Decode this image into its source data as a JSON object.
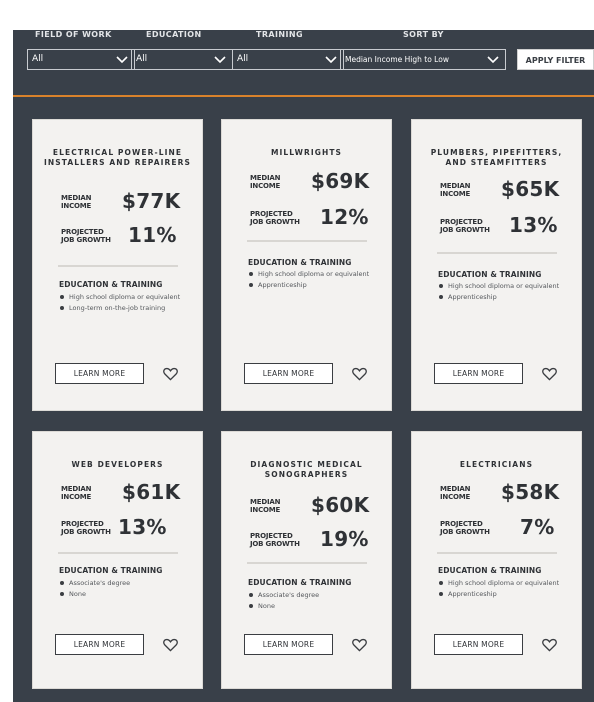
{
  "filters": {
    "field_label": "FIELD OF WORK",
    "field_value": "All",
    "education_label": "EDUCATION",
    "education_value": "All",
    "training_label": "TRAINING",
    "training_value": "All",
    "sort_label": "SORT BY",
    "sort_value": "Median Income High to Low",
    "apply_label": "APPLY FILTER"
  },
  "colors": {
    "background": "#394049",
    "accent_rule": "#d9822b",
    "card": "#f3f2f0"
  },
  "labels": {
    "median": "MEDIAN\nINCOME",
    "growth": "PROJECTED\nJOB GROWTH",
    "edu_title": "EDUCATION & TRAINING",
    "learn_more": "LEARN MORE"
  },
  "cards": [
    {
      "title": "ELECTRICAL POWER-LINE INSTALLERS AND REPAIRERS",
      "median": "$77K",
      "growth": "11%",
      "education": [
        "High school diploma or equivalent",
        "Long-term on-the-job training"
      ]
    },
    {
      "title": "MILLWRIGHTS",
      "median": "$69K",
      "growth": "12%",
      "education": [
        "High school diploma or equivalent",
        "Apprenticeship"
      ]
    },
    {
      "title": "PLUMBERS, PIPEFITTERS, AND STEAMFITTERS",
      "median": "$65K",
      "growth": "13%",
      "education": [
        "High school diploma or equivalent",
        "Apprenticeship"
      ]
    },
    {
      "title": "WEB DEVELOPERS",
      "median": "$61K",
      "growth": "13%",
      "education": [
        "Associate's degree",
        "None"
      ]
    },
    {
      "title": "DIAGNOSTIC MEDICAL SONOGRAPHERS",
      "median": "$60K",
      "growth": "19%",
      "education": [
        "Associate's degree",
        "None"
      ]
    },
    {
      "title": "ELECTRICIANS",
      "median": "$58K",
      "growth": "7%",
      "education": [
        "High school diploma or equivalent",
        "Apprenticeship"
      ]
    }
  ]
}
